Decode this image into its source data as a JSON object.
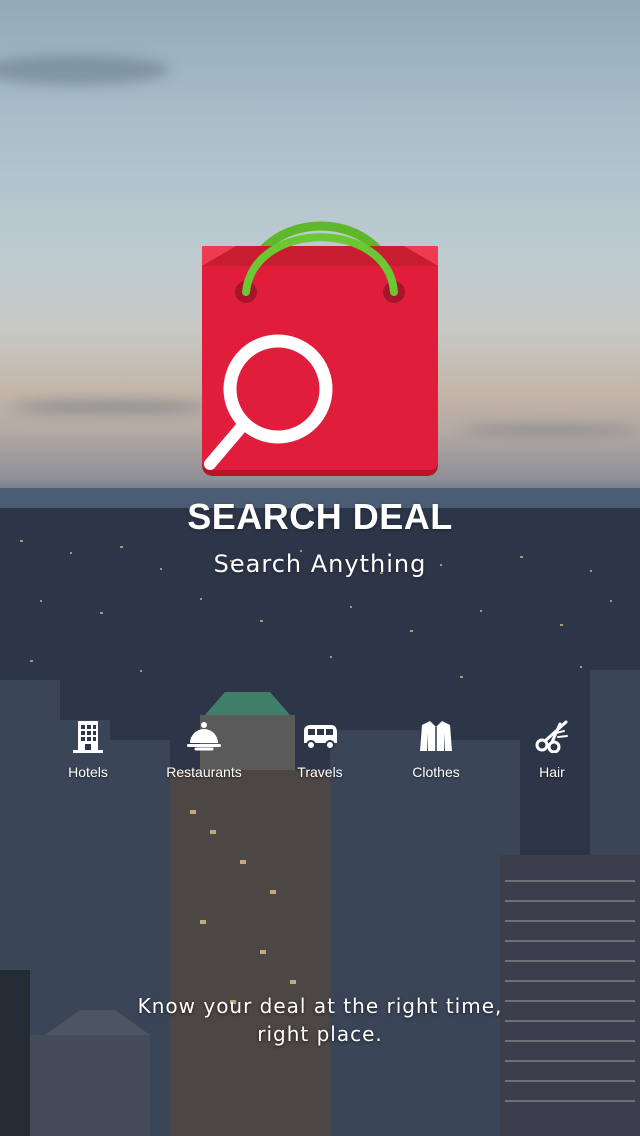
{
  "app": {
    "title": "SEARCH DEAL",
    "subtitle": "Search Anything"
  },
  "logo": {
    "icon": "shopping-bag-search-icon",
    "bag_color": "#e01e3c",
    "handle_color": "#5fb82a"
  },
  "categories": [
    {
      "label": "Hotels",
      "icon": "hotel-building-icon"
    },
    {
      "label": "Restaurants",
      "icon": "cloche-icon"
    },
    {
      "label": "Travels",
      "icon": "bus-icon"
    },
    {
      "label": "Clothes",
      "icon": "jacket-icon"
    },
    {
      "label": "Hair",
      "icon": "scissors-icon"
    }
  ],
  "tagline": {
    "line1": "Know your deal at the right time,",
    "line2": "right place."
  }
}
